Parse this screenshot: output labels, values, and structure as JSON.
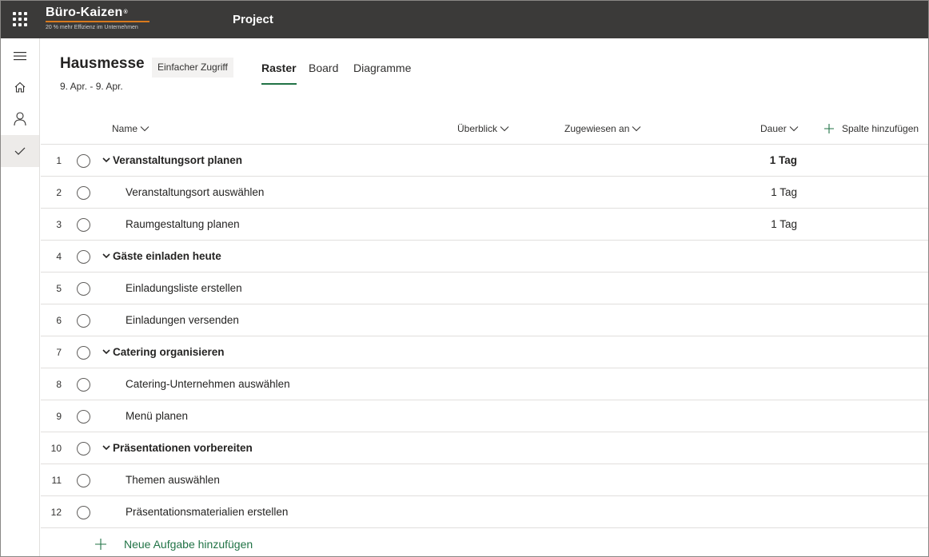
{
  "topbar": {
    "brand_name": "Büro-Kaizen",
    "brand_mark": "®",
    "brand_tagline": "20 % mehr Effizienz im Unternehmen",
    "app_title": "Project",
    "icons": [
      "app-launcher-icon"
    ]
  },
  "rail": {
    "items": [
      {
        "name": "menu",
        "icon": "hamburger-icon"
      },
      {
        "name": "home",
        "icon": "home-icon"
      },
      {
        "name": "profile",
        "icon": "person-icon"
      },
      {
        "name": "tasks",
        "icon": "checkmark-icon",
        "active": true
      }
    ]
  },
  "project": {
    "title": "Hausmesse",
    "access_badge": "Einfacher Zugriff",
    "dates": "9. Apr. - 9. Apr."
  },
  "tabs": [
    {
      "label": "Raster",
      "active": true
    },
    {
      "label": "Board",
      "active": false
    },
    {
      "label": "Diagramme",
      "active": false
    }
  ],
  "columns": {
    "name": "Name",
    "overview": "Überblick",
    "assigned": "Zugewiesen an",
    "duration": "Dauer",
    "add_column": "Spalte hinzufügen"
  },
  "tasks": [
    {
      "num": "1",
      "name": "Veranstaltungsort planen",
      "duration": "1 Tag",
      "parent": true
    },
    {
      "num": "2",
      "name": "Veranstaltungsort auswählen",
      "duration": "1 Tag",
      "parent": false
    },
    {
      "num": "3",
      "name": "Raumgestaltung planen",
      "duration": "1 Tag",
      "parent": false
    },
    {
      "num": "4",
      "name": "Gäste einladen heute",
      "duration": "",
      "parent": true
    },
    {
      "num": "5",
      "name": "Einladungsliste erstellen",
      "duration": "",
      "parent": false
    },
    {
      "num": "6",
      "name": "Einladungen versenden",
      "duration": "",
      "parent": false
    },
    {
      "num": "7",
      "name": "Catering organisieren",
      "duration": "",
      "parent": true
    },
    {
      "num": "8",
      "name": "Catering-Unternehmen auswählen",
      "duration": "",
      "parent": false
    },
    {
      "num": "9",
      "name": "Menü planen",
      "duration": "",
      "parent": false
    },
    {
      "num": "10",
      "name": "Präsentationen vorbereiten",
      "duration": "",
      "parent": true
    },
    {
      "num": "11",
      "name": "Themen auswählen",
      "duration": "",
      "parent": false
    },
    {
      "num": "12",
      "name": "Präsentationsmaterialien erstellen",
      "duration": "",
      "parent": false
    }
  ],
  "add_task_label": "Neue Aufgabe hinzufügen",
  "colors": {
    "topbar": "#3b3a39",
    "accent_green": "#217346",
    "brand_orange": "#d97a1e"
  }
}
